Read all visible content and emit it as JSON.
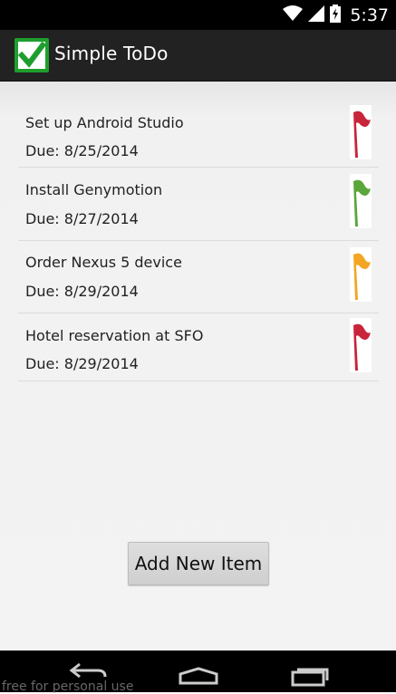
{
  "status_bar": {
    "time": "5:37",
    "icons": [
      "wifi-icon",
      "signal-icon",
      "battery-charging-icon"
    ]
  },
  "app": {
    "title": "Simple ToDo",
    "icon": "checkbox-check-icon"
  },
  "todos": [
    {
      "title": "Set up Android Studio",
      "due": "Due: 8/25/2014",
      "priority_color": "#c8243a"
    },
    {
      "title": "Install Genymotion",
      "due": "Due: 8/27/2014",
      "priority_color": "#5aa63a"
    },
    {
      "title": "Order Nexus 5 device",
      "due": "Due: 8/29/2014",
      "priority_color": "#f2a623"
    },
    {
      "title": "Hotel reservation at SFO",
      "due": "Due: 8/29/2014",
      "priority_color": "#c8243a"
    }
  ],
  "actions": {
    "add_label": "Add New Item"
  },
  "nav": {
    "back": "back-icon",
    "home": "home-icon",
    "recents": "recents-icon"
  },
  "watermark": "free for personal use",
  "colors": {
    "status_bar_bg": "#000000",
    "action_bar_bg": "#222222",
    "content_bg": "#f3f3f3",
    "app_icon_green": "#1f9e2e"
  }
}
